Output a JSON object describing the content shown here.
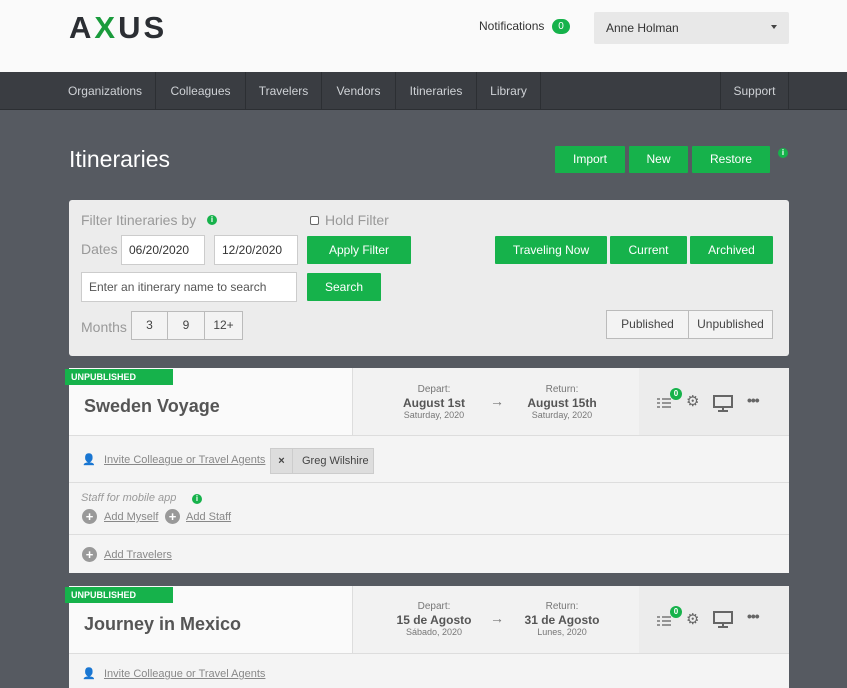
{
  "brand": {
    "logo_a": "A",
    "logo_x": "X",
    "logo_rest": "US",
    "accent_color": "#16b24b"
  },
  "header": {
    "notifications_label": "Notifications",
    "notifications_count": "0",
    "user_name": "Anne Holman"
  },
  "nav": {
    "items": [
      "Organizations",
      "Colleagues",
      "Travelers",
      "Vendors",
      "Itineraries",
      "Library"
    ],
    "support": "Support"
  },
  "page": {
    "title": "Itineraries",
    "import_label": "Import",
    "new_label": "New",
    "restore_label": "Restore",
    "info_icon": "i"
  },
  "filter": {
    "title": "Filter Itineraries by",
    "hold_filter_label": "Hold Filter",
    "dates_label": "Dates",
    "date_from": "06/20/2020",
    "date_to": "12/20/2020",
    "apply_label": "Apply Filter",
    "traveling_now_label": "Traveling Now",
    "current_label": "Current",
    "archived_label": "Archived",
    "search_placeholder": "Enter an itinerary name to search",
    "search_label": "Search",
    "months_label": "Months",
    "months_options": [
      "3",
      "9",
      "12+"
    ],
    "published_label": "Published",
    "unpublished_label": "Unpublished"
  },
  "itineraries": [
    {
      "status": "UNPUBLISHED",
      "name": "Sweden Voyage",
      "depart_label": "Depart:",
      "depart_date": "August 1st",
      "depart_day": "Saturday, 2020",
      "return_label": "Return:",
      "return_date": "August 15th",
      "return_day": "Saturday, 2020",
      "checklist_count": "0",
      "invite_label": "Invite Colleague or Travel Agents",
      "colleague": "Greg Wilshire",
      "staff_label": "Staff for mobile app",
      "add_myself_label": "Add Myself",
      "add_staff_label": "Add Staff",
      "add_travelers_label": "Add Travelers"
    },
    {
      "status": "UNPUBLISHED",
      "name": "Journey in Mexico",
      "depart_label": "Depart:",
      "depart_date": "15 de Agosto",
      "depart_day": "Sábado, 2020",
      "return_label": "Return:",
      "return_date": "31 de Agosto",
      "return_day": "Lunes, 2020",
      "checklist_count": "0",
      "invite_label": "Invite Colleague or Travel Agents"
    }
  ]
}
